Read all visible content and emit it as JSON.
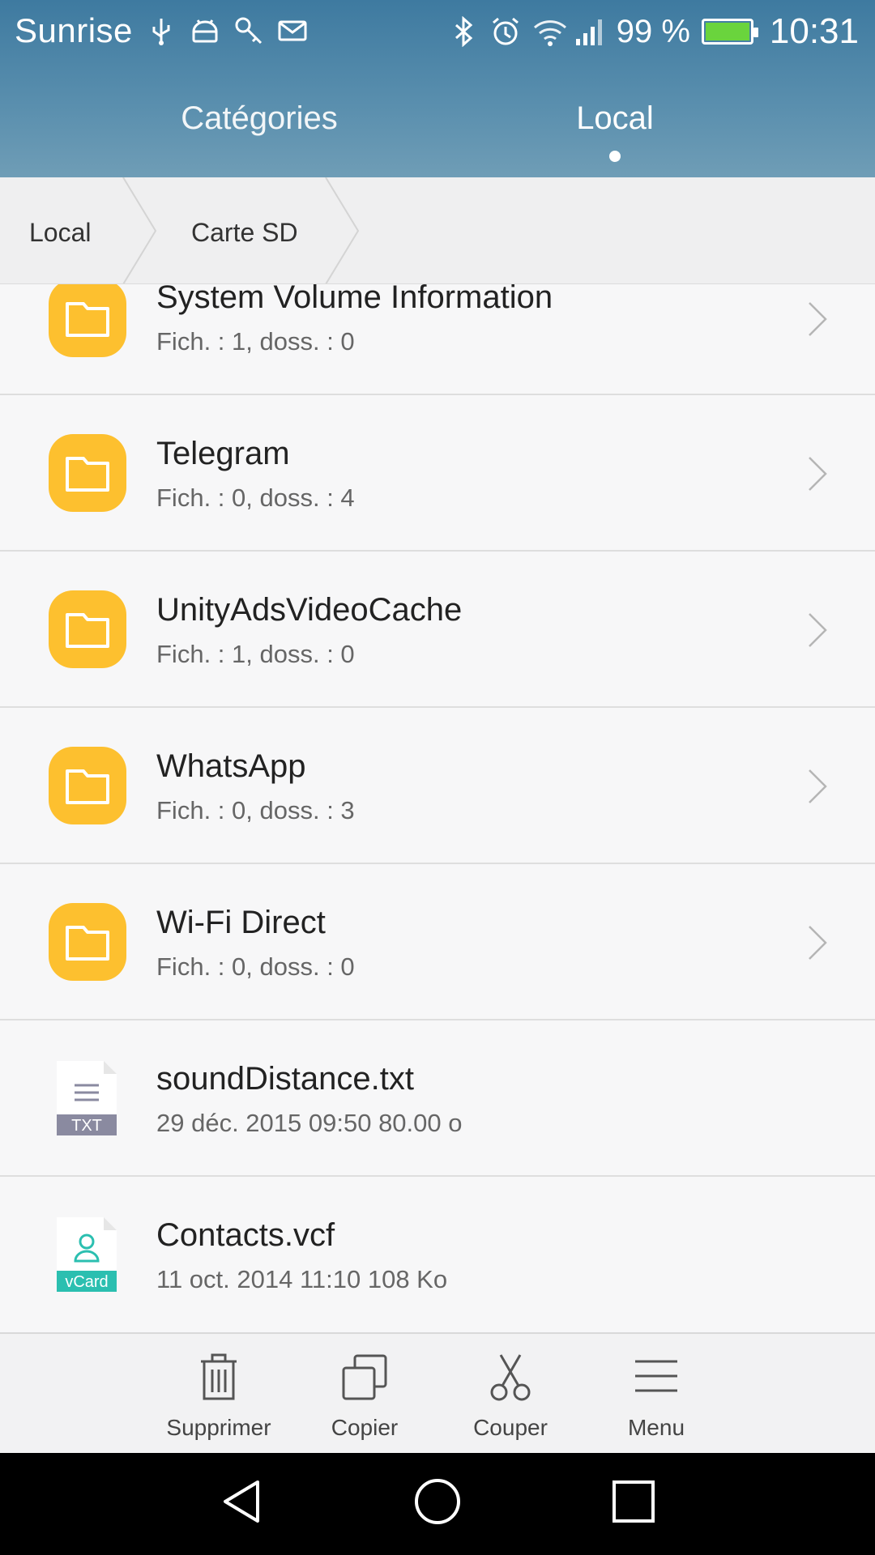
{
  "status": {
    "carrier": "Sunrise",
    "battery_percent": "99 %",
    "time": "10:31",
    "left_icons": [
      "usb-icon",
      "android-icon",
      "key-icon",
      "mail-icon"
    ],
    "right_icons": [
      "bluetooth-icon",
      "alarm-icon",
      "wifi-icon",
      "signal-icon",
      "battery-icon"
    ],
    "battery_level": 0.99
  },
  "tabs": [
    {
      "label": "Catégories",
      "active": false
    },
    {
      "label": "Local",
      "active": true
    }
  ],
  "breadcrumb": [
    "Local",
    "Carte SD"
  ],
  "items": [
    {
      "type": "folder",
      "name": "System Volume Information",
      "detail": "Fich. : 1, doss. : 0"
    },
    {
      "type": "folder",
      "name": "Telegram",
      "detail": "Fich. : 0, doss. : 4"
    },
    {
      "type": "folder",
      "name": "UnityAdsVideoCache",
      "detail": "Fich. : 1, doss. : 0"
    },
    {
      "type": "folder",
      "name": "WhatsApp",
      "detail": "Fich. : 0, doss. : 3"
    },
    {
      "type": "folder",
      "name": "Wi-Fi Direct",
      "detail": "Fich. : 0, doss. : 0"
    },
    {
      "type": "file",
      "name": "soundDistance.txt",
      "detail": "29 déc. 2015 09:50 80.00  o",
      "badge": "TXT"
    },
    {
      "type": "file",
      "name": "Contacts.vcf",
      "detail": "11 oct. 2014 11:10 108 Ko",
      "badge": "vCard"
    }
  ],
  "toolbar": {
    "delete": "Supprimer",
    "copy": "Copier",
    "cut": "Couper",
    "menu": "Menu"
  },
  "colors": {
    "folder": "#fdc02f",
    "header": "#4f86a8",
    "txt_badge": "#8a8aa0",
    "vcard_badge": "#2bbfb0"
  }
}
